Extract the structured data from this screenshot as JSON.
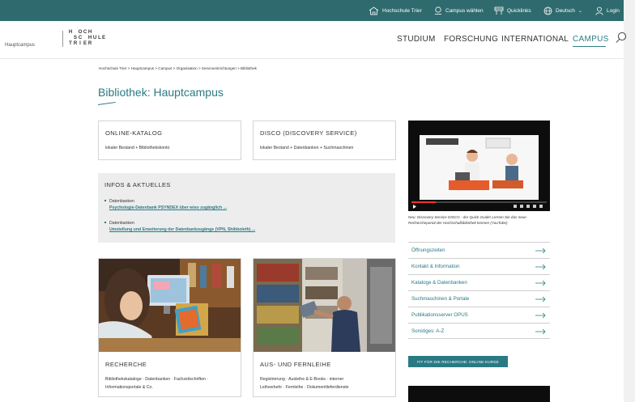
{
  "topbar": {
    "items": [
      {
        "label": "Hochschule Trier",
        "icon": "building-icon"
      },
      {
        "label": "Campus wählen",
        "icon": "map-pin-icon"
      },
      {
        "label": "Quicklinks",
        "icon": "quicklinks-icon"
      },
      {
        "label": "Deutsch",
        "icon": "globe-icon"
      },
      {
        "label": "Login",
        "icon": "user-icon"
      }
    ]
  },
  "header": {
    "campus_sub": "Hauptcampus",
    "logo_letters": [
      "H",
      "O",
      "C",
      "H",
      "S",
      "C",
      "H",
      "U",
      "L",
      "E",
      "T",
      "R",
      "I",
      "E",
      "R"
    ],
    "nav": [
      "STUDIUM",
      "FORSCHUNG",
      "INTERNATIONAL",
      "CAMPUS"
    ]
  },
  "breadcrumb": "Hochschule Trier > Hauptcampus > Campus > Organisation > Serviceeinrichtungen > Bibliothek",
  "title": "Bibliothek: Hauptcampus",
  "boxes": [
    {
      "title": "ONLINE-KATALOG",
      "sub": "lokaler Bestand + Bibliothekskonto"
    },
    {
      "title": "DISCO (DISCOVERY SERVICE)",
      "sub": "lokaler Bestand + Datenbanken + Suchmaschinen"
    }
  ],
  "infos": {
    "title": "INFOS & AKTUELLES",
    "items": [
      {
        "category": "Datenbanken",
        "link": "Psychologie-Datenbank PSYNDEX über wiso zugänglich ..."
      },
      {
        "category": "Datenbanken",
        "link": "Umstellung und Erweiterung der Datenbankzugänge (VPN, Shibboleth) ..."
      }
    ]
  },
  "cards": [
    {
      "title": "RECHERCHE",
      "line1": "Bibliothekskataloge · Datenbanken · Fachzeitschriften ·",
      "line2": "Informationsportale & Co."
    },
    {
      "title": "AUS- UND FERNLEIHE",
      "line1": "Registrierung · Ausleihe & E-Books · interner",
      "line2": "Leihverkehr · Fernleihe · Dokumentlieferdienste"
    }
  ],
  "video": {
    "caption": "Neu: Discovery Service DISCO - der Quick Guide! Lernen Sie das neue Rechercheportal der Hochschulbibliothek kennen (YouTube)"
  },
  "quicklinks": [
    "Öffnungszeiten",
    "Kontakt & Information",
    "Kataloge & Datenbanken",
    "Suchmaschinen & Portale",
    "Publikationsserver OPUS",
    "Sonstiges: A-Z"
  ],
  "cta": "FIT FÜR DIE RECHERCHE: ONLINE-KURSE",
  "colors": {
    "topbar": "#2f6b6e",
    "accent": "#2a7a83"
  }
}
